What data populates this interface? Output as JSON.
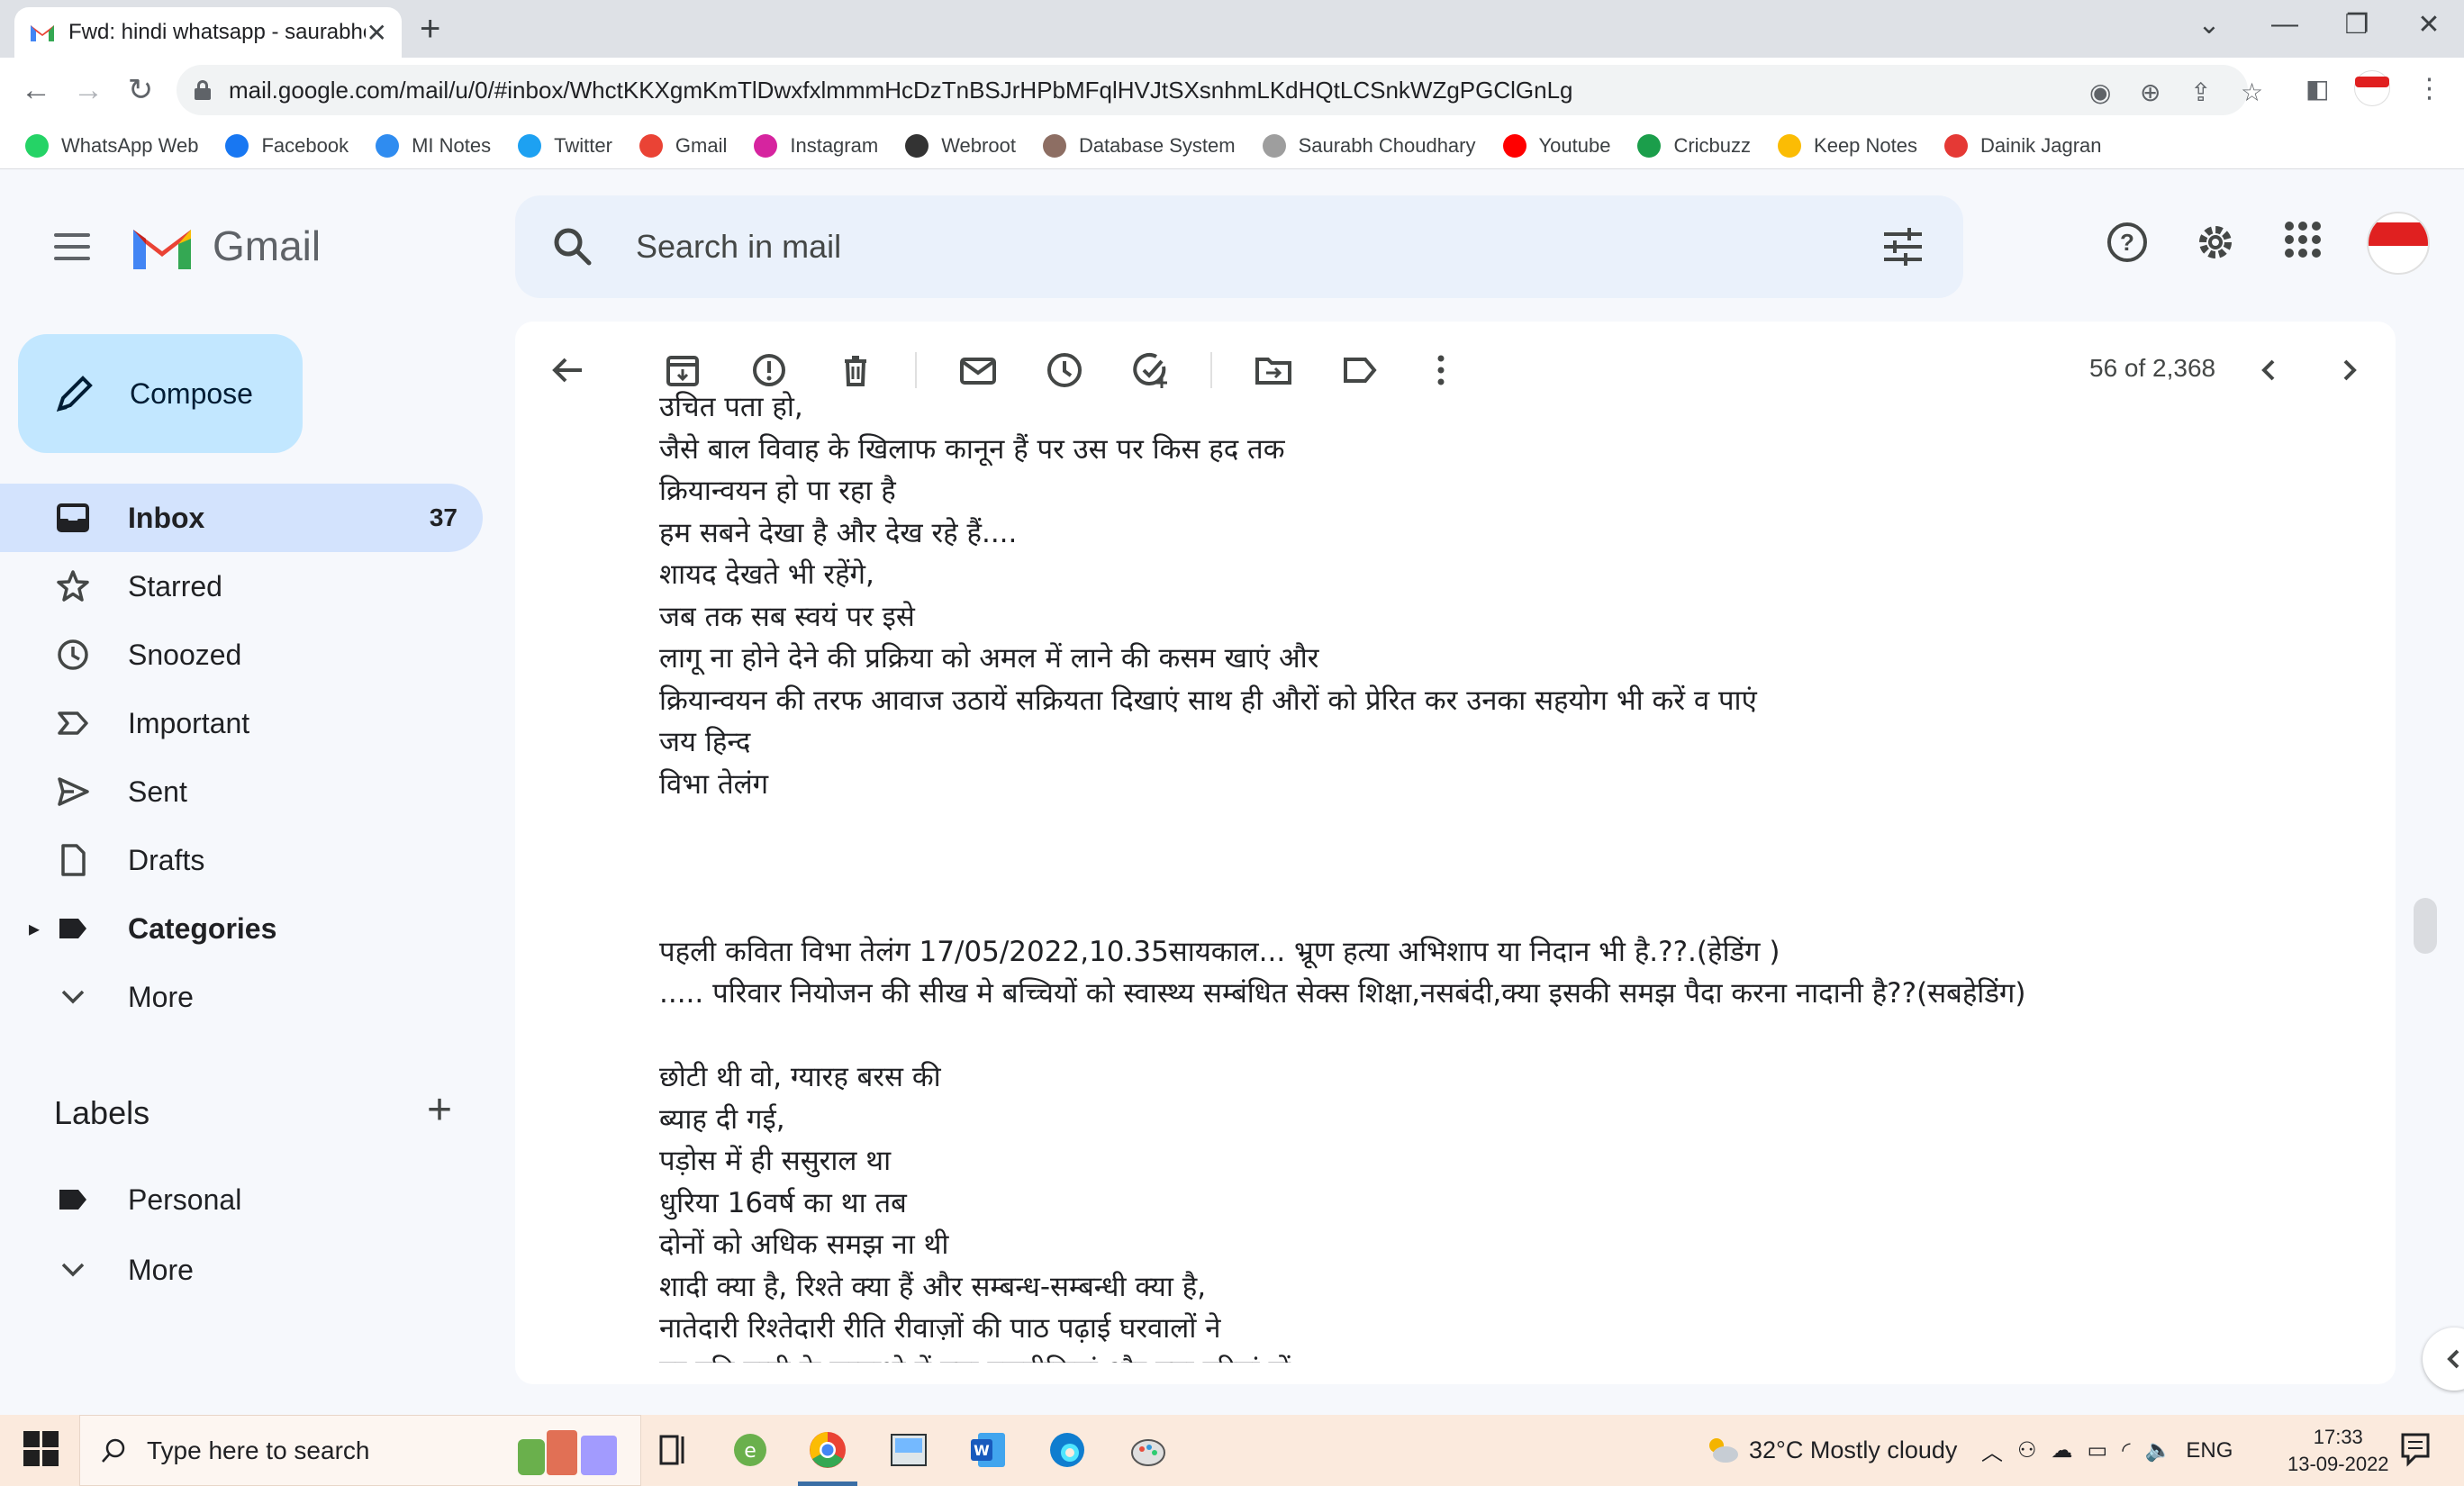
{
  "browser": {
    "tab_title": "Fwd: hindi whatsapp - saurabhch",
    "new_tab": "+",
    "close_tab": "✕",
    "url": "mail.google.com/mail/u/0/#inbox/WhctKKXgmKmTlDwxfxlmmmHcDzTnBSJrHPbMFqlHVJtSXsnhmLKdHQtLCSnkWZgPGClGnLg",
    "bookmarks": [
      {
        "label": "WhatsApp Web",
        "icon": "whatsapp-icon",
        "color": "#25d366"
      },
      {
        "label": "Facebook",
        "icon": "facebook-icon",
        "color": "#1877f2"
      },
      {
        "label": "MI Notes",
        "icon": "notes-icon",
        "color": "#2f8cf0"
      },
      {
        "label": "Twitter",
        "icon": "twitter-icon",
        "color": "#1da1f2"
      },
      {
        "label": "Gmail",
        "icon": "gmail-icon",
        "color": "#ea4335"
      },
      {
        "label": "Instagram",
        "icon": "instagram-icon",
        "color": "#d6249f"
      },
      {
        "label": "Webroot",
        "icon": "webroot-icon",
        "color": "#333333"
      },
      {
        "label": "Database System",
        "icon": "database-icon",
        "color": "#8d6e63"
      },
      {
        "label": "Saurabh Choudhary",
        "icon": "document-icon",
        "color": "#9e9e9e"
      },
      {
        "label": "Youtube",
        "icon": "youtube-icon",
        "color": "#ff0000"
      },
      {
        "label": "Cricbuzz",
        "icon": "cricbuzz-icon",
        "color": "#1b9e4b"
      },
      {
        "label": "Keep Notes",
        "icon": "keep-icon",
        "color": "#fbbc04"
      },
      {
        "label": "Dainik Jagran",
        "icon": "jagran-icon",
        "color": "#e53935"
      }
    ]
  },
  "gmail": {
    "logo_text": "Gmail",
    "search_placeholder": "Search in mail",
    "compose_label": "Compose",
    "nav": [
      {
        "label": "Inbox",
        "icon": "inbox-icon",
        "count": "37",
        "active": true
      },
      {
        "label": "Starred",
        "icon": "star-icon"
      },
      {
        "label": "Snoozed",
        "icon": "clock-icon"
      },
      {
        "label": "Important",
        "icon": "important-icon"
      },
      {
        "label": "Sent",
        "icon": "send-icon"
      },
      {
        "label": "Drafts",
        "icon": "draft-icon"
      },
      {
        "label": "Categories",
        "icon": "label-icon"
      },
      {
        "label": "More",
        "icon": "chevron-down-icon"
      }
    ],
    "labels_heading": "Labels",
    "labels_add": "+",
    "labels": [
      {
        "label": "Personal",
        "icon": "label-icon"
      },
      {
        "label": "More",
        "icon": "chevron-down-icon"
      }
    ],
    "pager": "56 of 2,368",
    "accent": "#d3e3fd",
    "compose_color": "#c2e7ff"
  },
  "message_lines": [
    "उचित पता हो,",
    "जैसे बाल विवाह के खिलाफ कानून हैं पर उस पर किस हद तक",
    "क्रियान्वयन हो पा रहा है",
    "हम सबने देखा है और देख रहे हैं....",
    "शायद देखते भी रहेंगे,",
    "जब तक सब स्वयं पर इसे",
    "लागू ना होने देने की प्रक्रिया को अमल में लाने की कसम खाएं और",
    " क्रियान्वयन की तरफ आवाज उठायें सक्रियता दिखाएं साथ ही औरों को प्रेरित कर उनका  सहयोग भी करें व पाएं",
    "जय हिन्द",
    "विभा तेलंग",
    "",
    "",
    "",
    "पहली कविता विभा तेलंग   17/05/2022,10.35सायकाल... भ्रूण हत्या अभिशाप या निदान भी है.??.(हेडिंग )",
    "..... परिवार नियोजन की सीख मे बच्चियों को स्वास्थ्य सम्बंधित सेक्स शिक्षा,नसबंदी,क्या इसकी समझ पैदा करना नादानी है??(सबहेडिंग)",
    "",
    "छोटी थी वो, ग्यारह बरस की",
    "ब्याह दी गई,",
    "पड़ोस में ही ससुराल था",
    "धुरिया 16वर्ष का था तब",
    "दोनों को अधिक समझ ना थी",
    "शादी क्या है, रिश्ते क्या हैं और सम्बन्ध-सम्बन्धी क्या है,",
    "नातेदारी रिश्तेदारी रीति रीवाज़ों की पाठ पढ़ाई घरवालों ने",
    "पर पति पत्नी के सम्बन्धो में क्या नजदीकियां और क्या दूरियां हों"
  ],
  "taskbar": {
    "search_placeholder": "Type here to search",
    "weather": "32°C  Mostly cloudy",
    "lang": "ENG",
    "time": "17:33",
    "date": "13-09-2022"
  }
}
